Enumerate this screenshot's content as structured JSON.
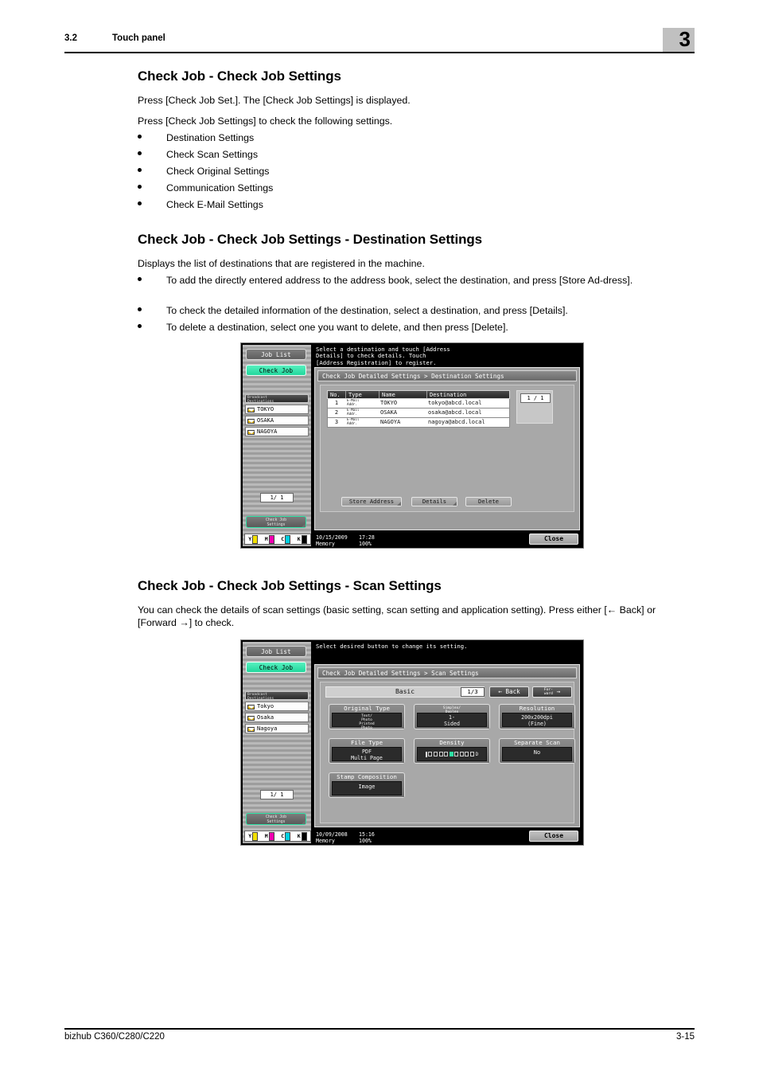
{
  "header": {
    "section_number": "3.2",
    "section_title": "Touch panel",
    "chapter": "3"
  },
  "footer": {
    "product": "bizhub C360/C280/C220",
    "page": "3-15"
  },
  "sections": [
    {
      "heading": "Check Job - Check Job Settings",
      "paragraphs": [
        "Press [Check Job Set.]. The [Check Job Settings] is displayed.",
        "Press [Check Job Settings] to check the following settings."
      ],
      "bullets": [
        "Destination Settings",
        "Check Scan Settings",
        "Check Original Settings",
        "Communication Settings",
        "Check E-Mail Settings"
      ]
    },
    {
      "heading": "Check Job - Check Job Settings - Destination Settings",
      "paragraphs": [
        "Displays the list of destinations that are registered in the machine."
      ],
      "bullets": [
        "To add the directly entered address to the address book, select the destination, and press [Store Ad-dress].",
        "To check the detailed information of the destination, select a destination, and press [Details].",
        "To delete a destination, select one you want to delete, and then press [Delete]."
      ]
    },
    {
      "heading": "Check Job - Check Job Settings - Scan Settings",
      "paragraphs": [
        "You can check the details of scan settings (basic setting, scan setting and application setting). Press either [← Back] or [Forward →] to check."
      ],
      "bullets": []
    }
  ],
  "panel1": {
    "rail": {
      "job_list_label": "Job List",
      "check_job_label": "Check Job",
      "broadcast_header": "Broadcast\nDestinations",
      "destinations": [
        "TOKYO",
        "OSAKA",
        "NAGOYA"
      ],
      "page_indicator": "1/  1",
      "check_job_settings_label": "Check Job\nSettings",
      "toner": [
        {
          "label": "Y",
          "color": "#f2e000"
        },
        {
          "label": "M",
          "color": "#f000b0"
        },
        {
          "label": "C",
          "color": "#00d0e0"
        },
        {
          "label": "K",
          "color": "#000000"
        }
      ]
    },
    "prompt": "Select a destination and touch [Address\nDetails] to check details. Touch\n[Address Registration] to register.",
    "breadcrumb": "Check Job Detailed Settings > Destination Settings",
    "table": {
      "columns": [
        "No.",
        "Type",
        "Name",
        "Destination"
      ],
      "rows": [
        {
          "no": "1",
          "type": "E-Mail\nAddr.",
          "name": "TOKYO",
          "destination": "tokyo@abcd.local"
        },
        {
          "no": "2",
          "type": "E-Mail\nAddr.",
          "name": "OSAKA",
          "destination": "osaka@abcd.local"
        },
        {
          "no": "3",
          "type": "E-Mail\nAddr.",
          "name": "NAGOYA",
          "destination": "nagoya@abcd.local"
        }
      ]
    },
    "pager": "1 / 1",
    "actions": [
      "Store Address",
      "Details",
      "Delete"
    ],
    "status": {
      "date": "10/15/2009",
      "time": "17:28",
      "memory_label": "Memory",
      "memory_value": "100%"
    },
    "close_label": "Close"
  },
  "panel2": {
    "rail": {
      "job_list_label": "Job List",
      "check_job_label": "Check Job",
      "broadcast_header": "Broadcast\nDestinations",
      "destinations": [
        "Tokyo",
        "Osaka",
        "Nagoya"
      ],
      "page_indicator": "1/  1",
      "check_job_settings_label": "Check Job\nSettings",
      "toner": [
        {
          "label": "Y",
          "color": "#f2e000"
        },
        {
          "label": "M",
          "color": "#f000b0"
        },
        {
          "label": "C",
          "color": "#00d0e0"
        },
        {
          "label": "K",
          "color": "#000000"
        }
      ]
    },
    "prompt": "Select desired button to change its setting.",
    "breadcrumb": "Check Job Detailed Settings > Scan Settings",
    "tab_label": "Basic",
    "tab_page": "1/3",
    "back_label": "Back",
    "forward_label": "For-\nward",
    "settings": [
      {
        "title": "Original Type",
        "value": "Text/\nPhoto\nPrinted\nPhoto",
        "style": "multi"
      },
      {
        "title": "Simplex/\nDuplex",
        "value": "1-\nSided",
        "style": "two",
        "title_tiny": true
      },
      {
        "title": "Resolution",
        "value": "200x200dpi\n(Fine)",
        "style": "two"
      },
      {
        "title": "File Type",
        "value": "PDF\nMulti Page",
        "style": "two"
      },
      {
        "title": "Density",
        "value": "",
        "style": "density"
      },
      {
        "title": "Separate Scan",
        "value": "No",
        "style": "one"
      },
      {
        "title": "Stamp Composition",
        "value": "Image",
        "style": "one"
      }
    ],
    "density": {
      "steps": 9,
      "selected": 5
    },
    "status": {
      "date": "10/09/2008",
      "time": "15:16",
      "memory_label": "Memory",
      "memory_value": "100%"
    },
    "close_label": "Close"
  }
}
